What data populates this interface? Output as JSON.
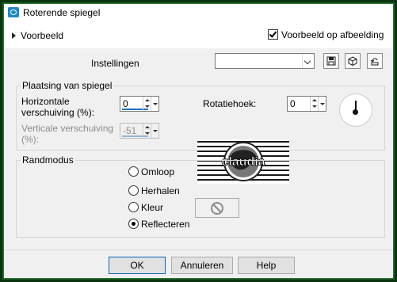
{
  "window": {
    "title": "Roterende spiegel"
  },
  "header": {
    "preview_label": "Voorbeeld",
    "preview_on_image_label": "Voorbeeld op afbeelding",
    "preview_on_image_checked": true
  },
  "settings": {
    "label": "Instellingen",
    "preset_value": "",
    "icons": [
      "save-icon",
      "cube-icon",
      "reset-icon"
    ]
  },
  "placement": {
    "group_label": "Plaatsing van spiegel",
    "horizontal_label_1": "Horizontale",
    "horizontal_label_2": "verschuiving (%):",
    "horizontal_value": "0",
    "vertical_label_1": "Verticale verschuiving",
    "vertical_label_2": "(%):",
    "vertical_value": "-51",
    "rotation_label": "Rotatiehoek:",
    "rotation_value": "0"
  },
  "edge_mode": {
    "group_label": "Randmodus",
    "options": [
      {
        "label": "Omloop",
        "selected": false
      },
      {
        "label": "Herhalen",
        "selected": false
      },
      {
        "label": "Kleur",
        "selected": false
      },
      {
        "label": "Reflecteren",
        "selected": true
      }
    ],
    "color_swatch_icon": "no-color-icon"
  },
  "watermark": {
    "text": "claudia"
  },
  "buttons": {
    "ok": "OK",
    "cancel": "Annuleren",
    "help": "Help"
  },
  "colors": {
    "frame": "#1d5a24",
    "accent": "#1a73c6"
  }
}
